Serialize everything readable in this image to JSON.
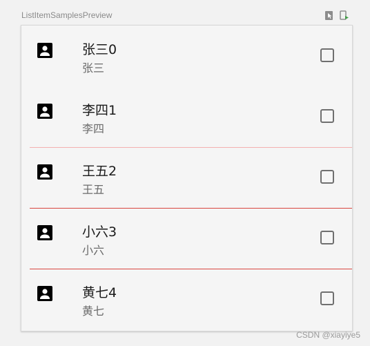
{
  "preview": {
    "title": "ListItemSamplesPreview",
    "toolbar_icons": [
      "interactive-mode-icon",
      "deploy-preview-icon"
    ]
  },
  "list": {
    "items": [
      {
        "headline": "张三0",
        "supporting": "张三",
        "checked": false,
        "divider": "none"
      },
      {
        "headline": "李四1",
        "supporting": "李四",
        "checked": false,
        "divider": "none"
      },
      {
        "headline": "王五2",
        "supporting": "王五",
        "checked": false,
        "divider": "light"
      },
      {
        "headline": "小六3",
        "supporting": "小六",
        "checked": false,
        "divider": "strong"
      },
      {
        "headline": "黄七4",
        "supporting": "黄七",
        "checked": false,
        "divider": "strong"
      }
    ],
    "leading_icon": "contact-icon"
  },
  "colors": {
    "divider_light": "#f3b0b0",
    "divider_strong": "#d8453e",
    "icon": "#000000",
    "checkbox_border": "#6f6f6f"
  },
  "watermark": "CSDN @xiayiye5"
}
